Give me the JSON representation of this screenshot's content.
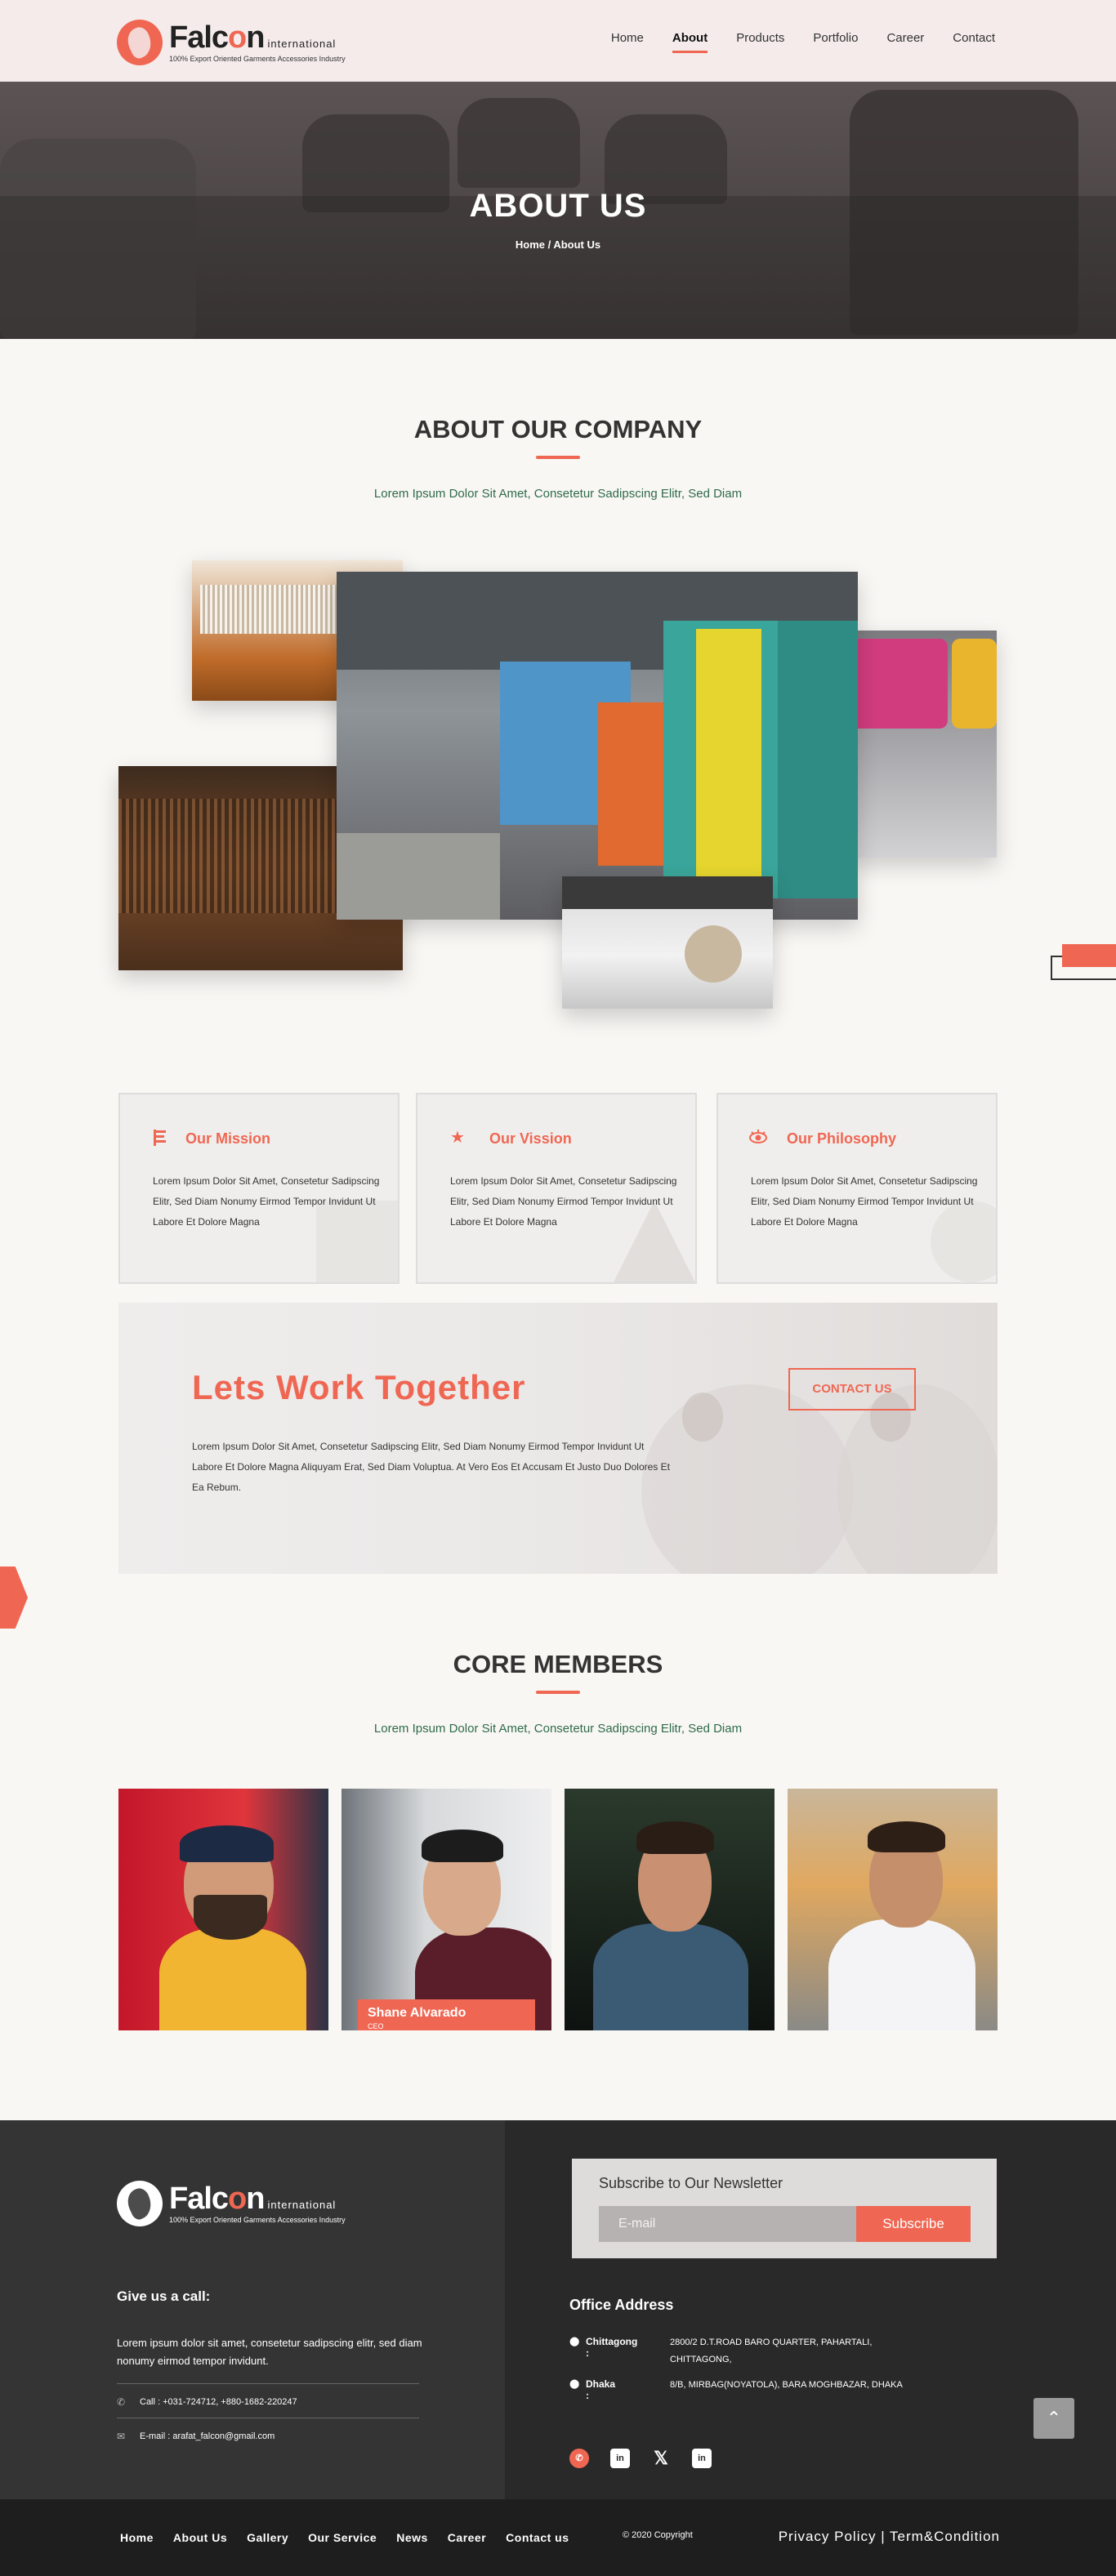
{
  "brand": {
    "name_prefix": "Falc",
    "name_o": "o",
    "name_suffix": "n",
    "suffix": "international",
    "tagline": "100% Export Oriented Garments Accessories Industry",
    "accent": "#ef6753"
  },
  "nav": {
    "items": [
      {
        "label": "Home"
      },
      {
        "label": "About"
      },
      {
        "label": "Products"
      },
      {
        "label": "Portfolio"
      },
      {
        "label": "Career"
      },
      {
        "label": "Contact"
      }
    ],
    "active": "About"
  },
  "hero": {
    "title": "ABOUT US",
    "breadcrumb": "Home / About Us"
  },
  "about": {
    "title": "ABOUT OUR COMPANY",
    "subtitle": "Lorem Ipsum Dolor Sit Amet, Consetetur Sadipscing Elitr, Sed Diam"
  },
  "cards": [
    {
      "icon": "mission-icon",
      "title": "Our Mission",
      "text": "Lorem Ipsum Dolor Sit Amet, Consetetur Sadipscing Elitr, Sed Diam Nonumy Eirmod Tempor Invidunt Ut Labore Et Dolore Magna"
    },
    {
      "icon": "star-icon",
      "title": "Our Vission",
      "text": "Lorem Ipsum Dolor Sit Amet, Consetetur Sadipscing Elitr, Sed Diam Nonumy Eirmod Tempor Invidunt Ut Labore Et Dolore Magna"
    },
    {
      "icon": "eye-icon",
      "title": "Our Philosophy",
      "text": "Lorem Ipsum Dolor Sit Amet, Consetetur Sadipscing Elitr, Sed Diam Nonumy Eirmod Tempor Invidunt Ut Labore Et Dolore Magna"
    }
  ],
  "work": {
    "title": "Lets Work Together",
    "text": "Lorem Ipsum Dolor Sit Amet, Consetetur Sadipscing Elitr, Sed Diam Nonumy Eirmod Tempor Invidunt Ut Labore Et Dolore Magna Aliquyam Erat, Sed Diam Voluptua. At Vero Eos Et Accusam Et Justo Duo Dolores Et Ea Rebum.",
    "button": "CONTACT US"
  },
  "members": {
    "title": "CORE MEMBERS",
    "subtitle": "Lorem Ipsum Dolor Sit Amet, Consetetur Sadipscing Elitr, Sed Diam",
    "featured": {
      "name": "Shane Alvarado",
      "role": "CEO"
    }
  },
  "footer": {
    "call_title": "Give us a call:",
    "call_text": "Lorem ipsum dolor sit amet, consetetur sadipscing elitr, sed diam nonumy eirmod tempor invidunt.",
    "call": "Call :  +031-724712, +880-1682-220247",
    "email": "E-mail :      arafat_falcon@gmail.com",
    "newsletter_title": "Subscribe to Our Newsletter",
    "newsletter_placeholder": "E-mail",
    "newsletter_button": "Subscribe",
    "office_title": "Office Address",
    "offices": [
      {
        "city": "Chittagong :",
        "address": "2800/2 D.T.ROAD BARO QUARTER, PAHARTALI, CHITTAGONG,"
      },
      {
        "city": "Dhaka :",
        "address": "8/B, MIRBAG(NOYATOLA), BARA MOGHBAZAR, DHAKA"
      }
    ],
    "socials": [
      "whatsapp-icon",
      "linkedin-icon",
      "twitter-icon",
      "linkedin-icon"
    ]
  },
  "bottom": {
    "links": [
      "Home",
      "About Us",
      "Gallery",
      "Our Service",
      "News",
      "Career",
      "Contact us"
    ],
    "copyright": "© 2020 Copyright",
    "policy": "Privacy Policy | Term&Condition"
  }
}
